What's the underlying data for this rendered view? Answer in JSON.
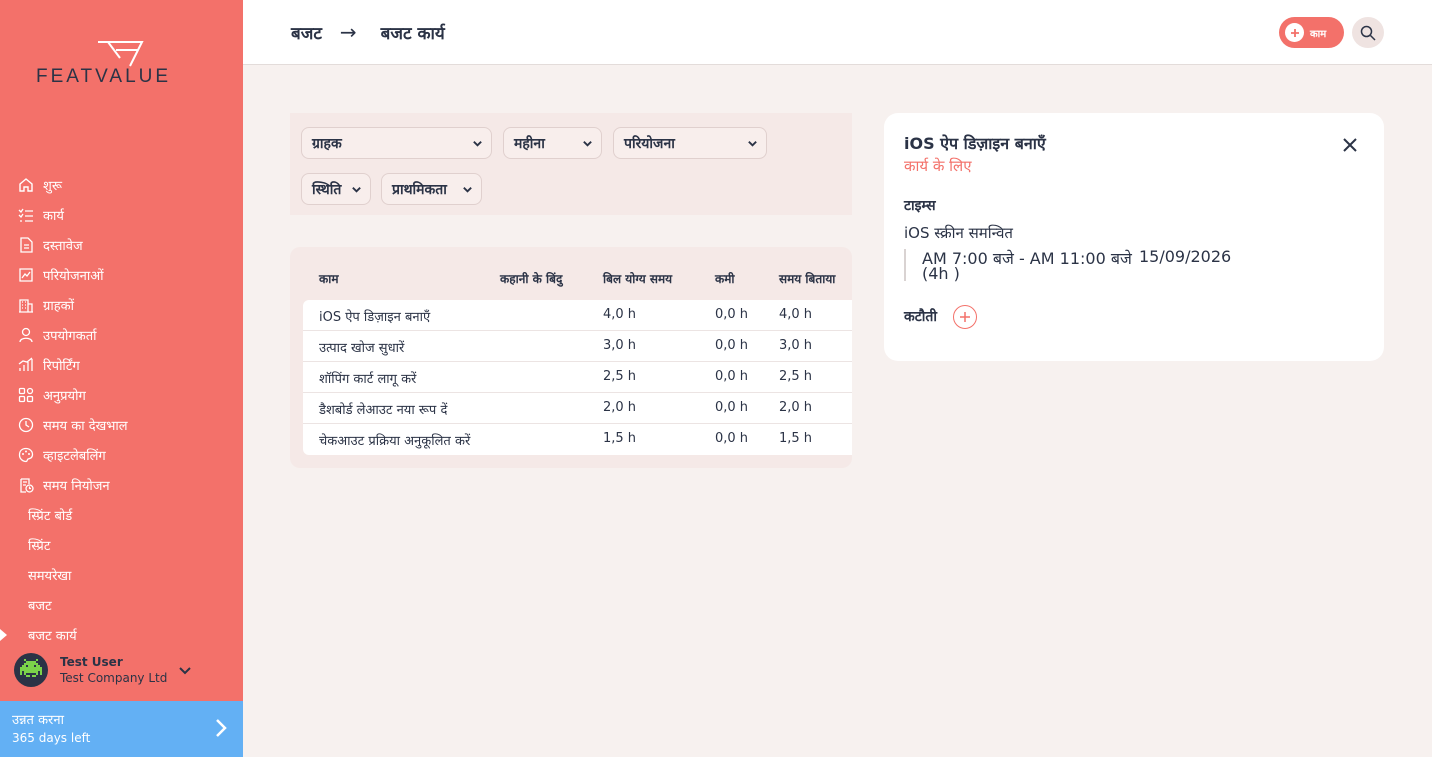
{
  "brand": {
    "name": "FEATVALUE",
    "accent": "#f3716a",
    "upgrade_color": "#63b0f4"
  },
  "sidebar": {
    "items": [
      {
        "label": "शुरू",
        "icon": "home-icon"
      },
      {
        "label": "कार्य",
        "icon": "tasks-icon"
      },
      {
        "label": "दस्तावेज",
        "icon": "documents-icon"
      },
      {
        "label": "परियोजनाओं",
        "icon": "projects-icon"
      },
      {
        "label": "ग्राहकों",
        "icon": "clients-icon"
      },
      {
        "label": "उपयोगकर्ता",
        "icon": "user-icon"
      },
      {
        "label": "रिपोर्टिंग",
        "icon": "reporting-icon"
      },
      {
        "label": "अनुप्रयोग",
        "icon": "apps-icon"
      },
      {
        "label": "समय का देखभाल",
        "icon": "timer-icon"
      },
      {
        "label": "व्हाइटलेबलिंग",
        "icon": "palette-icon"
      },
      {
        "label": "समय नियोजन",
        "icon": "planning-icon"
      }
    ],
    "subitems": [
      {
        "label": "स्प्रिंट बोर्ड"
      },
      {
        "label": "स्प्रिंट"
      },
      {
        "label": "समयरेखा"
      },
      {
        "label": "बजट"
      },
      {
        "label": "बजट कार्य",
        "active": true
      }
    ],
    "user": {
      "name": "Test User",
      "company": "Test Company Ltd"
    },
    "upgrade": {
      "title": "उन्नत करना",
      "subtitle": "365 days left"
    }
  },
  "header": {
    "breadcrumb": [
      "बजट",
      "बजट कार्य"
    ],
    "arrow": "→",
    "add_label": "काम"
  },
  "filters": {
    "customer": "ग्राहक",
    "month": "महीना",
    "project": "परियोजना",
    "status": "स्थिति",
    "priority": "प्राथमिकता"
  },
  "table": {
    "columns": [
      "काम",
      "कहानी के बिंदु",
      "बिल योग्य समय",
      "कमी",
      "समय बिताया"
    ],
    "rows": [
      {
        "task": "iOS ऐप डिज़ाइन बनाएँ",
        "points": "",
        "billable": "4,0 h",
        "deficit": "0,0 h",
        "spent": "4,0 h"
      },
      {
        "task": "उत्पाद खोज सुधारें",
        "points": "",
        "billable": "3,0 h",
        "deficit": "0,0 h",
        "spent": "3,0 h"
      },
      {
        "task": "शॉपिंग कार्ट लागू करें",
        "points": "",
        "billable": "2,5 h",
        "deficit": "0,0 h",
        "spent": "2,5 h"
      },
      {
        "task": "डैशबोर्ड लेआउट नया रूप दें",
        "points": "",
        "billable": "2,0 h",
        "deficit": "0,0 h",
        "spent": "2,0 h"
      },
      {
        "task": "चेकआउट प्रक्रिया अनुकूलित करें",
        "points": "",
        "billable": "1,5 h",
        "deficit": "0,0 h",
        "spent": "1,5 h"
      }
    ]
  },
  "detail": {
    "title": "iOS ऐप डिज़ाइन बनाएँ",
    "subtitle": "कार्य के लिए",
    "times_label": "टाइम्स",
    "entry_name": "iOS स्क्रीन समन्वित",
    "time_range": "AM 7:00 बजे - AM 11:00 बजे",
    "date": "15/09/2026",
    "duration": "(4h )",
    "deductions_label": "कटौती"
  }
}
